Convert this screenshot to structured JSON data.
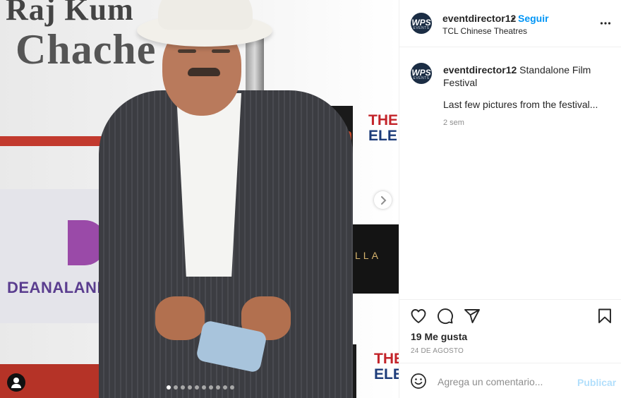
{
  "post": {
    "username": "eventdirector12",
    "separator": "•",
    "follow_label": "Seguir",
    "location": "TCL Chinese Theatres",
    "avatar_text": "WPS",
    "avatar_subtext": "EVENTS"
  },
  "caption": {
    "username": "eventdirector12",
    "title_text": "Standalone Film Festival",
    "text": "Last few pictures from the festival...",
    "time": "2 sem"
  },
  "engagement": {
    "likes": "19 Me gusta",
    "date": "24 DE AGOSTO"
  },
  "comment": {
    "placeholder": "Agrega un comentario...",
    "publish_label": "Publicar"
  },
  "carousel": {
    "total_slides": 10,
    "current_slide": 1
  },
  "photo_backdrop": {
    "top_text_1": "Raj Kum",
    "top_text_2": "Chache",
    "logo_text_main": "DEANALAND PRO",
    "logo_letter": "D",
    "banner_text_1": "THE",
    "banner_text_2": "ELE",
    "banner_text_3": "LLA"
  },
  "colors": {
    "accent": "#0095f6",
    "publish_disabled": "#b2dffc",
    "muted": "#8e8e8e",
    "text": "#262626"
  }
}
